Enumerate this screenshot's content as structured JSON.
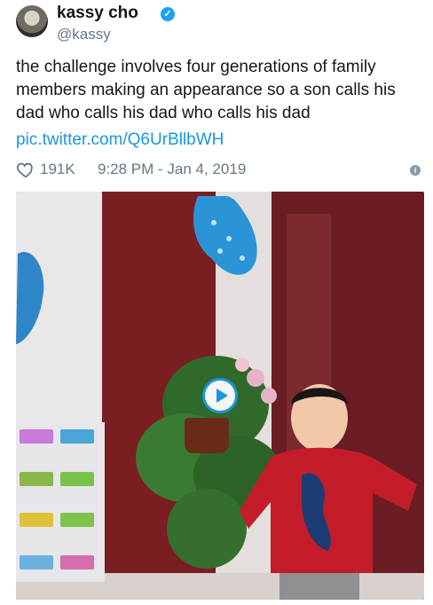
{
  "tweet": {
    "author_name": "kassy cho",
    "handle": "@kassy",
    "text": "the challenge involves four generations of family members making an appearance so a son calls his dad who calls his dad who calls his dad",
    "link": "pic.twitter.com/Q6UrBllbWH",
    "likes": "191K",
    "timestamp": "9:28 PM - Jan 4, 2019"
  },
  "icons": {
    "verified": "verified-badge-icon",
    "like": "heart-icon",
    "info": "info-icon",
    "play": "play-icon"
  },
  "colors": {
    "link": "#1b95e0",
    "verified": "#1da1f2",
    "muted": "#657786"
  }
}
